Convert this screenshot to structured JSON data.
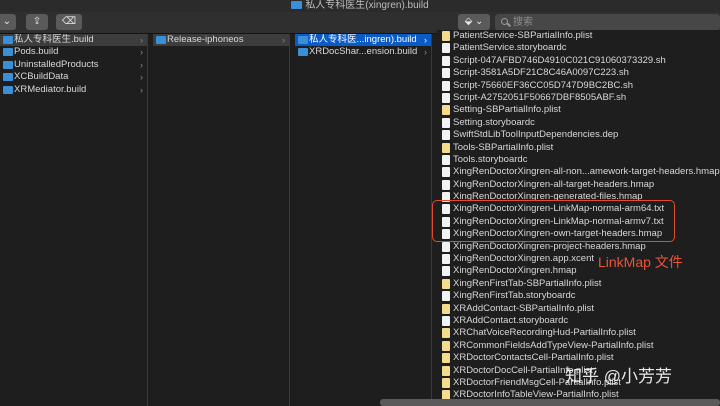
{
  "window": {
    "title": "私人专科医生(xingren).build"
  },
  "toolbar": {
    "search_placeholder": "搜索"
  },
  "columns": {
    "c1": [
      "私人专科医生.build",
      "Pods.build",
      "UninstalledProducts",
      "XCBuildData",
      "XRMediator.build"
    ],
    "c2": [
      "Release-iphoneos"
    ],
    "c3": [
      "私人专科医...ingren).build",
      "XRDocShar...ension.build"
    ],
    "c4": [
      "PatientService-SBPartialInfo.plist",
      "PatientService.storyboardc",
      "Script-047AFBD746D4910C021C91060373329.sh",
      "Script-3581A5DF21C8C46A0097C223.sh",
      "Script-75660EF36CC05D747D9BC2BC.sh",
      "Script-A2752051F50667DBF8505ABF.sh",
      "Setting-SBPartialInfo.plist",
      "Setting.storyboardc",
      "SwiftStdLibToolInputDependencies.dep",
      "Tools-SBPartialInfo.plist",
      "Tools.storyboardc",
      "XingRenDoctorXingren-all-non...amework-target-headers.hmap",
      "XingRenDoctorXingren-all-target-headers.hmap",
      "XingRenDoctorXingren-generated-files.hmap",
      "XingRenDoctorXingren-LinkMap-normal-arm64.txt",
      "XingRenDoctorXingren-LinkMap-normal-armv7.txt",
      "XingRenDoctorXingren-own-target-headers.hmap",
      "XingRenDoctorXingren-project-headers.hmap",
      "XingRenDoctorXingren.app.xcent",
      "XingRenDoctorXingren.hmap",
      "XingRenFirstTab-SBPartialInfo.plist",
      "XingRenFirstTab.storyboardc",
      "XRAddContact-SBPartialInfo.plist",
      "XRAddContact.storyboardc",
      "XRChatVoiceRecordingHud-PartialInfo.plist",
      "XRCommonFieldsAddTypeView-PartialInfo.plist",
      "XRDoctorContactsCell-PartialInfo.plist",
      "XRDoctorDocCell-PartialInfo.plist",
      "XRDoctorFriendMsgCell-PartialInfo.plist",
      "XRDoctorInfoTableView-PartialInfo.plist"
    ]
  },
  "annotation": {
    "label": "LinkMap 文件"
  },
  "watermark": "知乎 @小芳芳"
}
